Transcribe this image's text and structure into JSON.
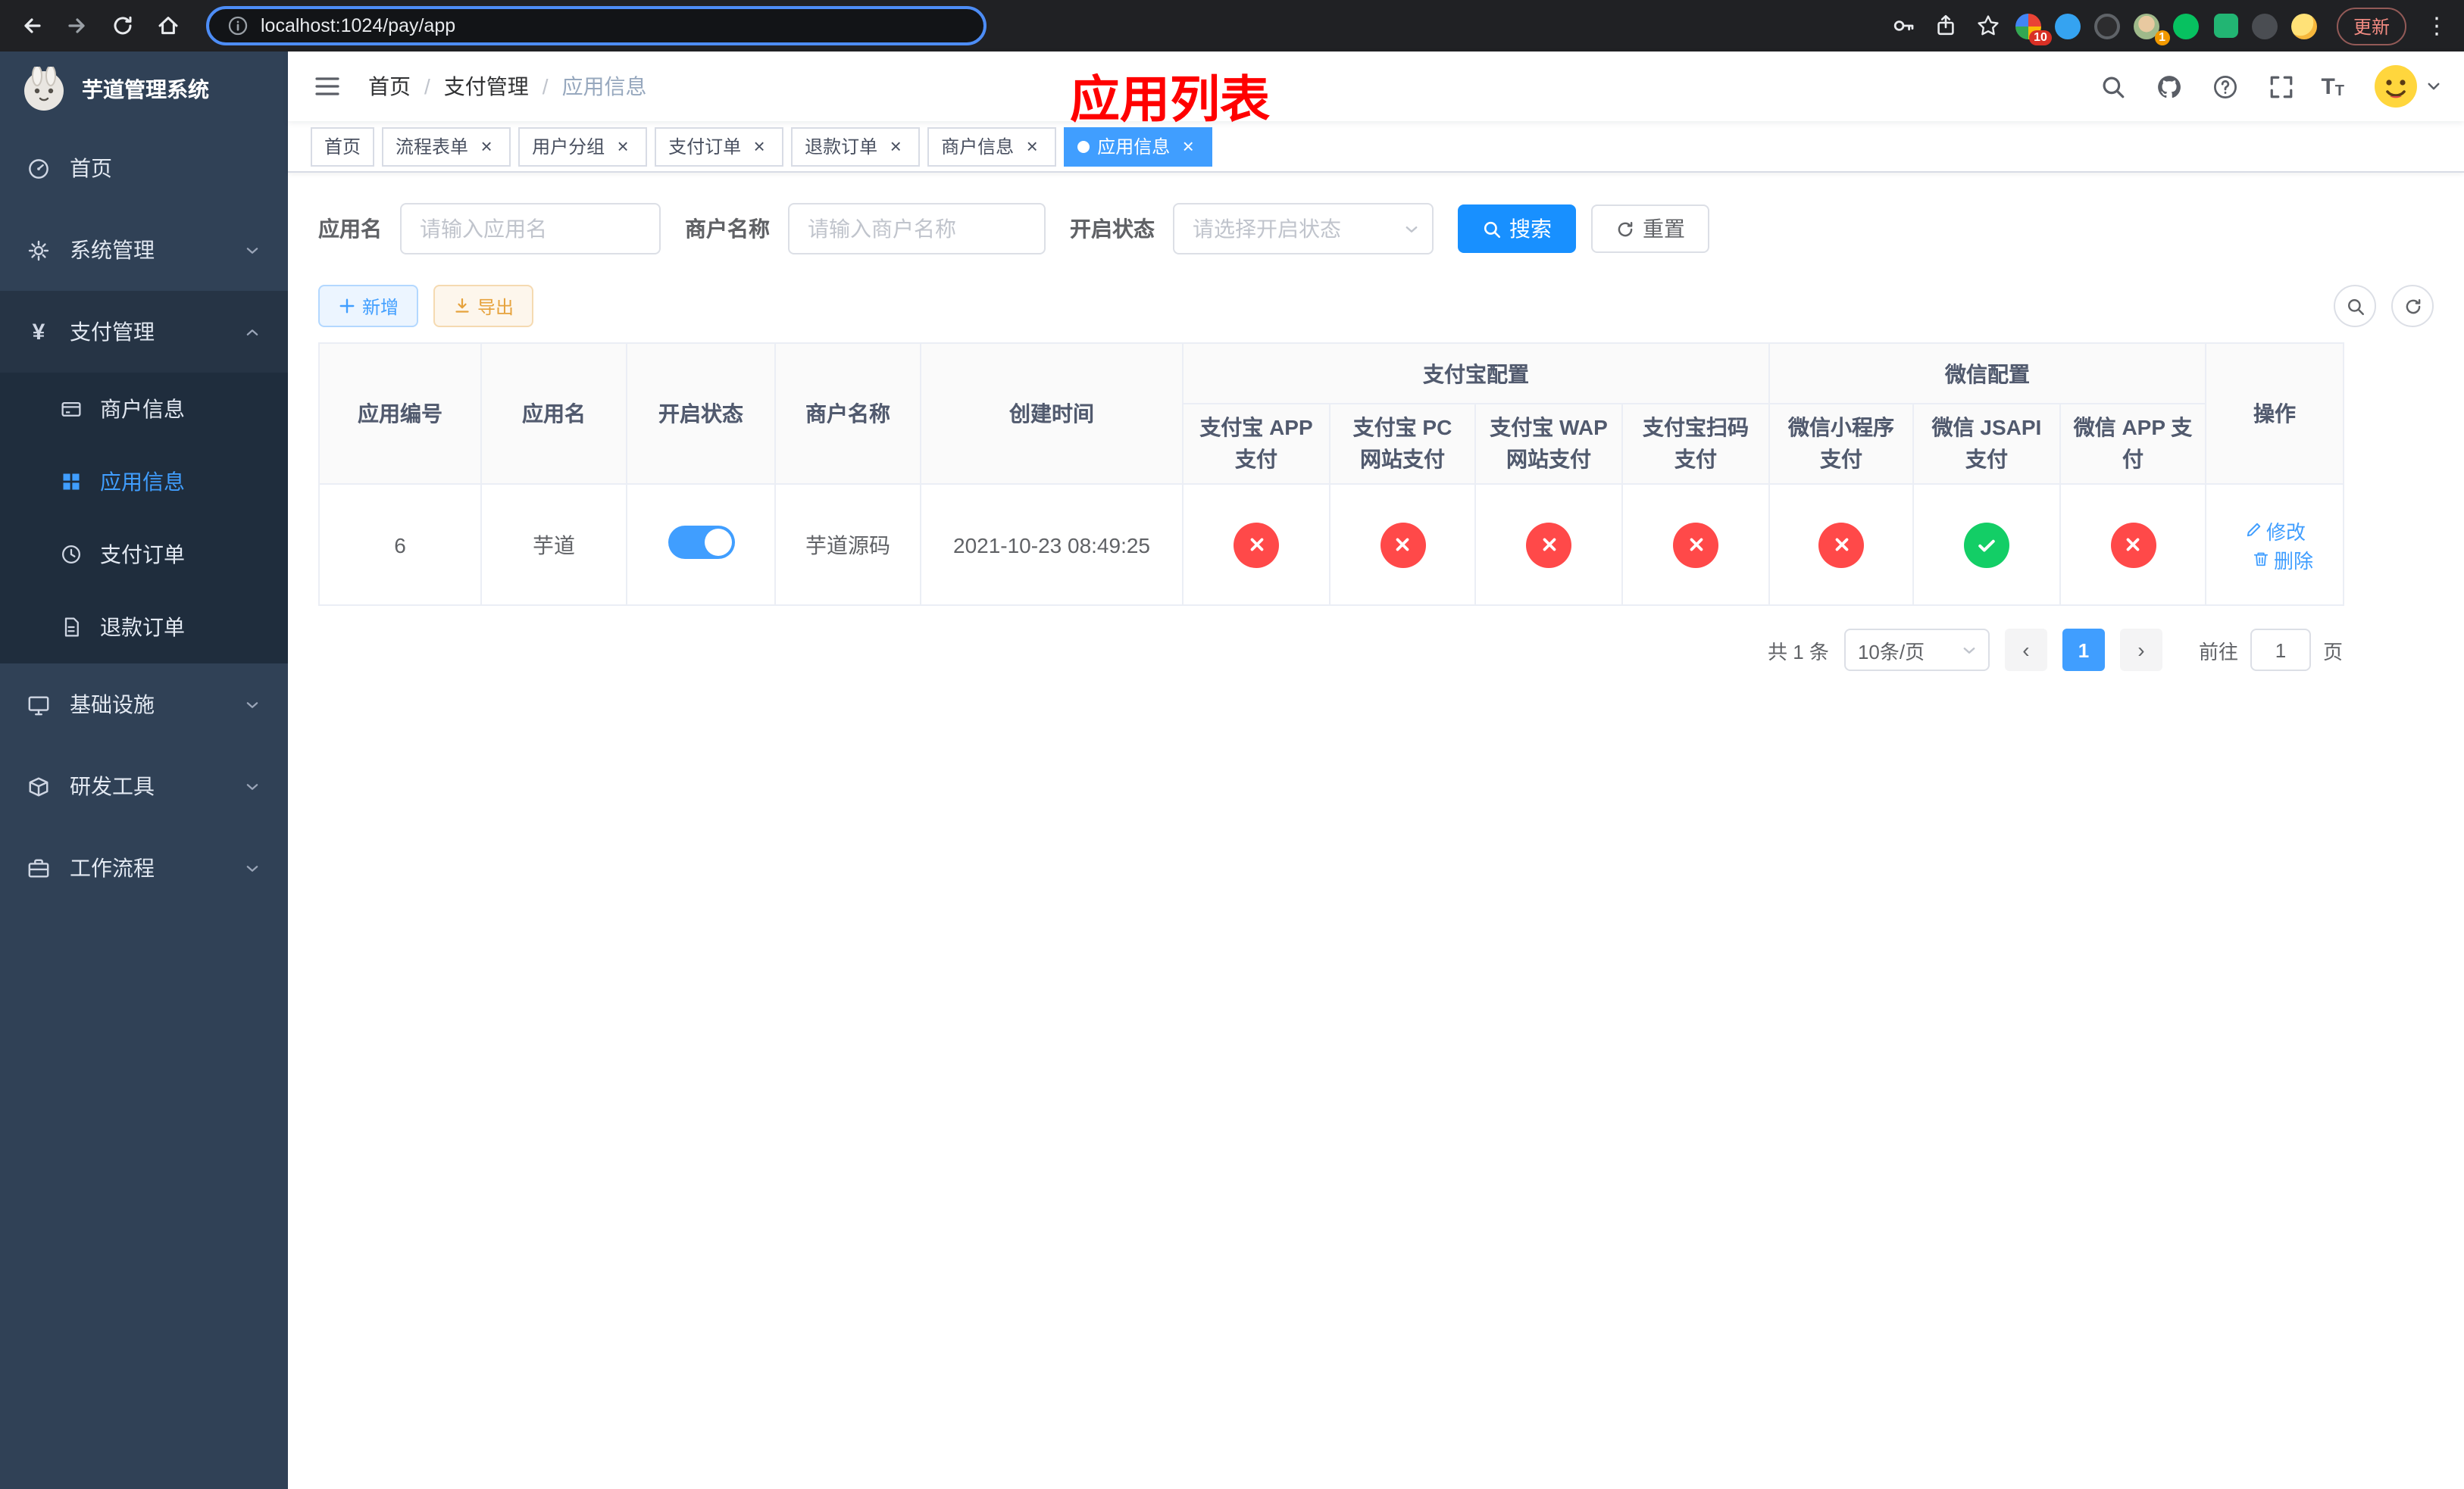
{
  "colors": {
    "accent": "#409eff",
    "search_button": "#1890ff",
    "danger_circle": "#ff4949",
    "success_circle": "#13ce66",
    "sidebar_bg": "#304156",
    "page_title_red": "#ff0000"
  },
  "browser": {
    "url": "localhost:1024/pay/app",
    "update_label": "更新",
    "extension_badge_count": "10",
    "profile_badge_count": "1"
  },
  "sidebar": {
    "app_title": "芋道管理系统",
    "items": {
      "home": "首页",
      "system": "系统管理",
      "payment": "支付管理",
      "merchant_info": "商户信息",
      "app_info": "应用信息",
      "pay_order": "支付订单",
      "refund_order": "退款订单",
      "infrastructure": "基础设施",
      "dev_tools": "研发工具",
      "workflow": "工作流程"
    }
  },
  "header": {
    "breadcrumb": [
      "首页",
      "支付管理",
      "应用信息"
    ],
    "page_title": "应用列表"
  },
  "tabs": [
    {
      "label": "首页"
    },
    {
      "label": "流程表单"
    },
    {
      "label": "用户分组"
    },
    {
      "label": "支付订单"
    },
    {
      "label": "退款订单"
    },
    {
      "label": "商户信息"
    },
    {
      "label": "应用信息"
    }
  ],
  "filters": {
    "app_name_label": "应用名",
    "app_name_placeholder": "请输入应用名",
    "merchant_label": "商户名称",
    "merchant_placeholder": "请输入商户名称",
    "status_label": "开启状态",
    "status_placeholder": "请选择开启状态",
    "search_label": "搜索",
    "reset_label": "重置"
  },
  "toolbar": {
    "add_label": "新增",
    "export_label": "导出"
  },
  "table": {
    "headers": {
      "app_id": "应用编号",
      "app_name": "应用名",
      "status": "开启状态",
      "merchant_name": "商户名称",
      "create_time": "创建时间",
      "alipay_group": "支付宝配置",
      "wechat_group": "微信配置",
      "alipay_app": "支付宝 APP 支付",
      "alipay_pc": "支付宝 PC 网站支付",
      "alipay_wap": "支付宝 WAP 网站支付",
      "alipay_qr": "支付宝扫码支付",
      "wechat_mini": "微信小程序支付",
      "wechat_jsapi": "微信 JSAPI 支付",
      "wechat_app": "微信 APP 支付",
      "actions": "操作"
    },
    "rows": [
      {
        "app_id": "6",
        "app_name": "芋道",
        "enabled": true,
        "merchant_name": "芋道源码",
        "create_time": "2021-10-23 08:49:25",
        "alipay_app": false,
        "alipay_pc": false,
        "alipay_wap": false,
        "alipay_qr": false,
        "wechat_mini": false,
        "wechat_jsapi": true,
        "wechat_app": false,
        "edit_label": "修改",
        "delete_label": "删除"
      }
    ]
  },
  "pagination": {
    "total_text": "共 1 条",
    "page_size_text": "10条/页",
    "current_page": "1",
    "goto_text": "前往",
    "goto_value": "1",
    "page_unit": "页"
  }
}
